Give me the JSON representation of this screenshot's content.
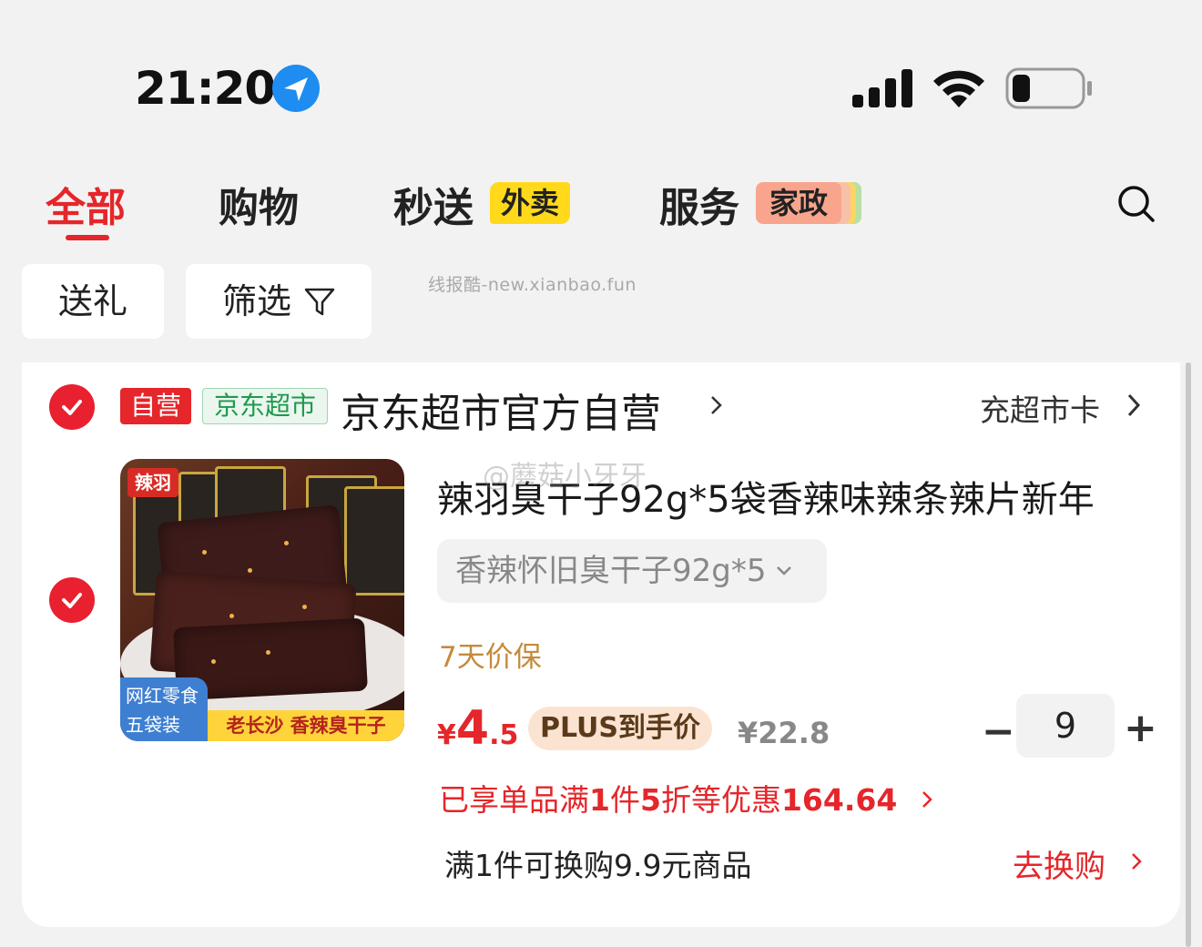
{
  "status_bar": {
    "time": "21:20",
    "icons": [
      "location-arrow-icon",
      "signal-icon",
      "wifi-icon",
      "battery-icon"
    ],
    "battery_level": 0.15
  },
  "tabs": [
    {
      "label": "全部",
      "active": true
    },
    {
      "label": "购物",
      "active": false
    },
    {
      "label": "秒送",
      "tag": "外卖",
      "active": false
    },
    {
      "label": "服务",
      "tag": "家政",
      "active": false
    }
  ],
  "search_icon": "search-icon",
  "filters": {
    "gift_label": "送礼",
    "filter_label": "筛选"
  },
  "watermark": "线报酷-new.xianbao.fun",
  "store": {
    "self_badge": "自营",
    "jd_badge": "京东超市",
    "name": "京东超市官方自营",
    "recharge": "充超市卡"
  },
  "product": {
    "image_texts": {
      "brand": "辣羽",
      "badge_line1": "网红零食",
      "badge_line2": "五袋装",
      "banner": "老长沙 香辣臭干子"
    },
    "title": "辣羽臭干子92g*5袋香辣味辣条辣片新年",
    "overlay_watermark": "@蘑菇小牙牙",
    "variant": "香辣怀旧臭干子92g*5",
    "guarantee": "7天价保",
    "price": {
      "currency": "¥",
      "integer": "4",
      "decimal": ".5"
    },
    "plus_tag": "PLUS到手价",
    "original_price": "¥22.8",
    "quantity": "9",
    "qty_minus": "−",
    "qty_plus": "+",
    "discount_prefix": "已享单品满",
    "discount_bold1": "1",
    "discount_mid": "件",
    "discount_bold2": "5",
    "discount_mid2": "折等优惠",
    "discount_amount": "164.64",
    "exchange_text": "满1件可换购9.9元商品",
    "exchange_link": "去换购"
  },
  "colors": {
    "accent": "#e5262a",
    "background": "#f2f2f2",
    "tag_yellow": "#ffd91a",
    "tag_salmon": "#f9a58d",
    "guarantee": "#c58a3c"
  }
}
